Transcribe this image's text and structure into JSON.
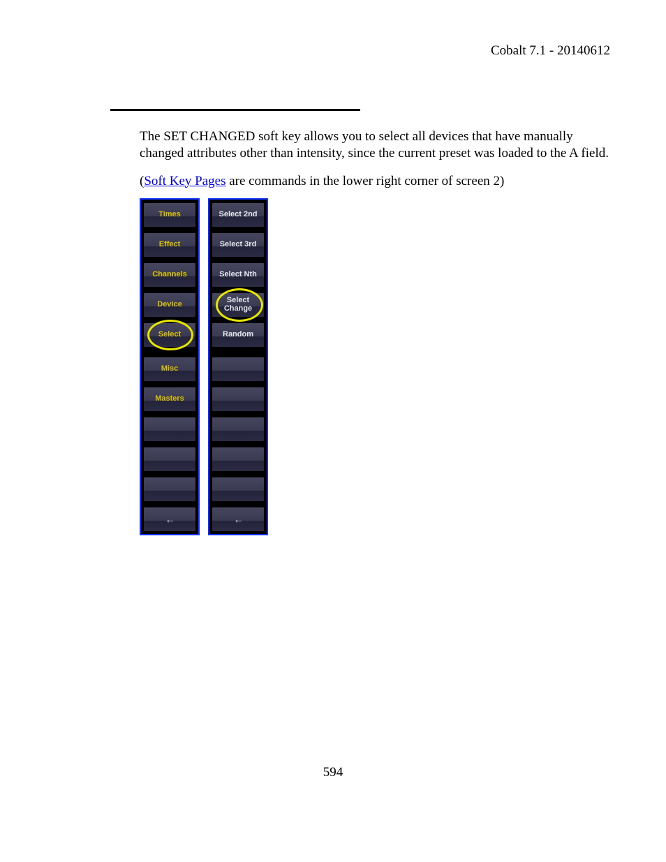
{
  "header": {
    "doc_title": "Cobalt 7.1 - 20140612"
  },
  "body": {
    "para1": "The SET CHANGED soft key allows you to select all devices that have manually changed attributes other than intensity, since the current preset was loaded to the A field.",
    "para2_prefix": "(",
    "link_text": "Soft Key Pages",
    "para2_suffix": " are commands in the lower right corner of screen 2)"
  },
  "softkeys": {
    "left": [
      {
        "label": "Times",
        "style": "yellow"
      },
      {
        "label": "Effect",
        "style": "yellow"
      },
      {
        "label": "Channels",
        "style": "yellow"
      },
      {
        "label": "Device",
        "style": "yellow"
      },
      {
        "label": "Select",
        "style": "yellow",
        "highlight": "select"
      },
      {
        "label": "Misc",
        "style": "yellow",
        "spacer_before": true
      },
      {
        "label": "Masters",
        "style": "yellow"
      },
      {
        "label": ""
      },
      {
        "label": ""
      },
      {
        "label": ""
      },
      {
        "label": "arrow",
        "style": "white",
        "arrow": true
      }
    ],
    "right": [
      {
        "label": "Select 2nd",
        "style": "white"
      },
      {
        "label": "Select 3rd",
        "style": "white"
      },
      {
        "label": "Select Nth",
        "style": "white"
      },
      {
        "label": "Select\nChange",
        "style": "white",
        "highlight": "change"
      },
      {
        "label": "Random",
        "style": "white"
      },
      {
        "label": "",
        "spacer_before": true
      },
      {
        "label": ""
      },
      {
        "label": ""
      },
      {
        "label": ""
      },
      {
        "label": ""
      },
      {
        "label": "arrow",
        "style": "white",
        "arrow": true
      }
    ]
  },
  "page_number": "594"
}
